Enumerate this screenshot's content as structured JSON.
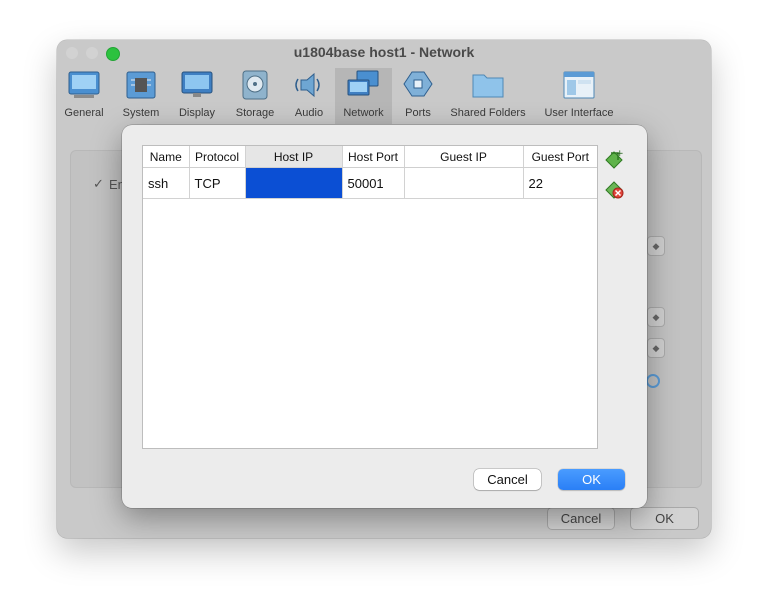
{
  "window": {
    "title": "u1804base host1 - Network",
    "traffic_lights": [
      {
        "name": "close",
        "color": "#d2d2d2"
      },
      {
        "name": "minimize",
        "color": "#d2d2d2"
      },
      {
        "name": "zoom",
        "color": "#2cc23f"
      }
    ]
  },
  "toolbar": {
    "items": [
      {
        "label": "General",
        "icon": "general-icon",
        "selected": false
      },
      {
        "label": "System",
        "icon": "chip-icon",
        "selected": false
      },
      {
        "label": "Display",
        "icon": "monitor-icon",
        "selected": false
      },
      {
        "label": "Storage",
        "icon": "disk-icon",
        "selected": false
      },
      {
        "label": "Audio",
        "icon": "speaker-icon",
        "selected": false
      },
      {
        "label": "Network",
        "icon": "network-icon",
        "selected": true
      },
      {
        "label": "Ports",
        "icon": "port-icon",
        "selected": false
      },
      {
        "label": "Shared Folders",
        "icon": "folder-icon",
        "selected": false
      },
      {
        "label": "User Interface",
        "icon": "window-layout-icon",
        "selected": false
      }
    ]
  },
  "background": {
    "enable_label_fragment": "En",
    "check_mark": "✓",
    "cancel_label": "Cancel",
    "ok_label": "OK"
  },
  "dialog": {
    "columns": [
      "Name",
      "Protocol",
      "Host IP",
      "Host Port",
      "Guest IP",
      "Guest Port"
    ],
    "active_column": "Host IP",
    "rows": [
      {
        "name": "ssh",
        "protocol": "TCP",
        "host_ip": "",
        "host_port": "50001",
        "guest_ip": "",
        "guest_port": "22"
      }
    ],
    "selection_color": "#0b4fd4",
    "add_rule_icon": "add-rule-icon",
    "remove_rule_icon": "remove-rule-icon",
    "cancel_label": "Cancel",
    "ok_label": "OK"
  }
}
